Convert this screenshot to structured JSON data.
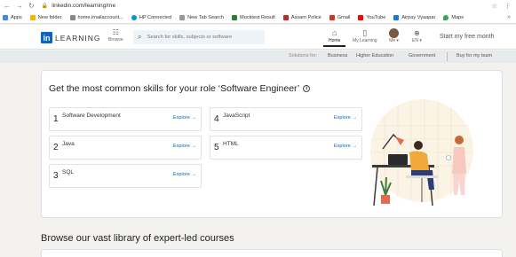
{
  "browser": {
    "url": "linkedin.com/learning/me",
    "bookmarks": [
      {
        "label": "Apps",
        "color": "#4285f4"
      },
      {
        "label": "New folder",
        "color": "#f4b400"
      },
      {
        "label": "home.imailaccount...",
        "color": "#888888"
      },
      {
        "label": "HP Connected",
        "color": "#0096d6"
      },
      {
        "label": "New Tab Search",
        "color": "#999999"
      },
      {
        "label": "Mocktest Result",
        "color": "#2e7d32"
      },
      {
        "label": "Assam Police",
        "color": "#c62828"
      },
      {
        "label": "Gmail",
        "color": "#d93025"
      },
      {
        "label": "YouTube",
        "color": "#ff0000"
      },
      {
        "label": "Airpay Vyaapar",
        "color": "#1a73e8"
      },
      {
        "label": "Maps",
        "color": "#34a853"
      }
    ]
  },
  "header": {
    "logo_text": "LEARNING",
    "logo_in": "in",
    "browse_label": "Browse",
    "search_placeholder": "Search for skills, subjects or software",
    "home_label": "Home",
    "mylearning_label": "My Learning",
    "me_label": "Me ▾",
    "lang_label": "EN ▾",
    "trial_label": "Start my free month"
  },
  "subnav": {
    "solutions_for": "Solutions for:",
    "business": "Business",
    "higher_ed": "Higher Education",
    "government": "Government",
    "buy": "Buy for my team"
  },
  "role_card": {
    "title": "Get the most common skills for your role ‘Software Engineer’",
    "explore_label": "Explore →",
    "skills": [
      {
        "num": "1",
        "name": "Software Development"
      },
      {
        "num": "2",
        "name": "Java"
      },
      {
        "num": "3",
        "name": "SQL"
      },
      {
        "num": "4",
        "name": "JavaScript"
      },
      {
        "num": "5",
        "name": "HTML"
      }
    ]
  },
  "browse_section": {
    "title": "Browse our vast library of expert-led courses"
  },
  "colors": {
    "brand": "#0a66c2",
    "page_bg": "#f3f2ef"
  }
}
